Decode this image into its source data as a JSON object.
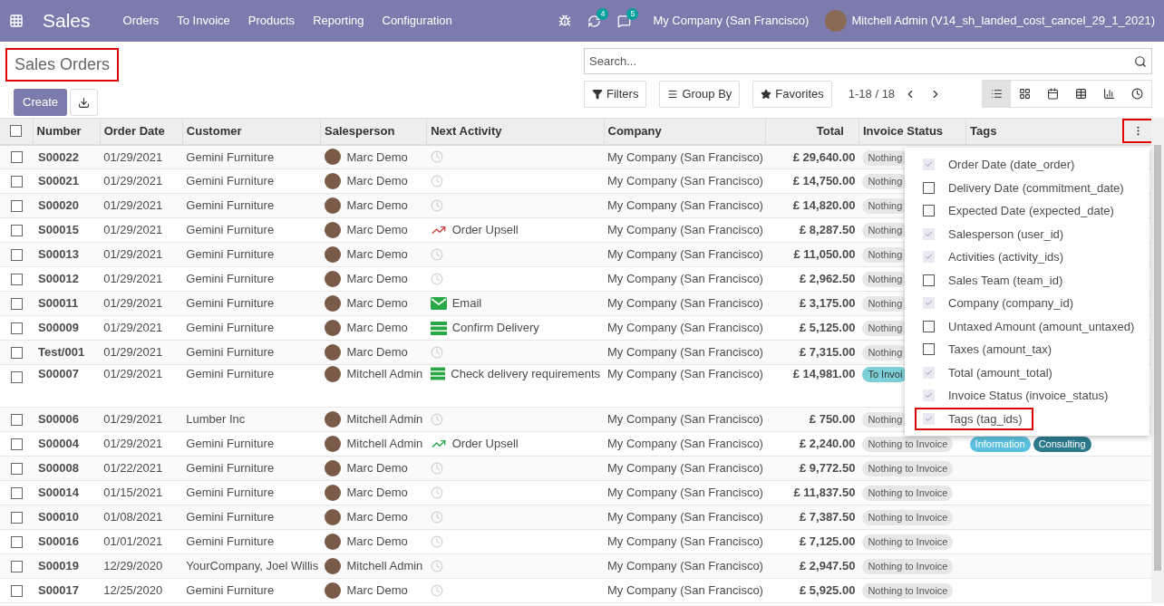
{
  "navbar": {
    "app": "Sales",
    "menu": [
      "Orders",
      "To Invoice",
      "Products",
      "Reporting",
      "Configuration"
    ],
    "activity_count": "4",
    "message_count": "5",
    "company": "My Company (San Francisco)",
    "user": "Mitchell Admin (V14_sh_landed_cost_cancel_29_1_2021)"
  },
  "title": {
    "text": "Sales Orders",
    "highlighted": true
  },
  "buttons": {
    "create": "Create"
  },
  "search": {
    "placeholder": "Search..."
  },
  "filters": [
    "Filters",
    "Group By",
    "Favorites"
  ],
  "pager": "1-18 / 18",
  "views": [
    {
      "kind": "list",
      "selected": true
    },
    {
      "kind": "kanban",
      "selected": false
    },
    {
      "kind": "calendar",
      "selected": false
    },
    {
      "kind": "pivot",
      "selected": false
    },
    {
      "kind": "graph",
      "selected": false
    },
    {
      "kind": "activity",
      "selected": false
    }
  ],
  "table": {
    "columns": [
      "Number",
      "Order Date",
      "Customer",
      "Salesperson",
      "Next Activity",
      "Company",
      "Total",
      "Invoice Status",
      "Tags"
    ],
    "menu_highlighted": true,
    "select_all_checked": false,
    "rows": [
      {
        "checked": false,
        "number": "S00022",
        "date": "01/29/2021",
        "customer": "Gemini Furniture",
        "salesperson": "Marc Demo",
        "activity": {
          "kind": "none"
        },
        "company": "My Company (San Francisco)",
        "total": "£ 29,640.00",
        "status": {
          "text": "Nothing",
          "kind": "nothing"
        },
        "tags": []
      },
      {
        "checked": false,
        "number": "S00021",
        "date": "01/29/2021",
        "customer": "Gemini Furniture",
        "salesperson": "Marc Demo",
        "activity": {
          "kind": "none"
        },
        "company": "My Company (San Francisco)",
        "total": "£ 14,750.00",
        "status": {
          "text": "Nothing",
          "kind": "nothing"
        },
        "tags": []
      },
      {
        "checked": false,
        "number": "S00020",
        "date": "01/29/2021",
        "customer": "Gemini Furniture",
        "salesperson": "Marc Demo",
        "activity": {
          "kind": "none"
        },
        "company": "My Company (San Francisco)",
        "total": "£ 14,820.00",
        "status": {
          "text": "Nothing",
          "kind": "nothing"
        },
        "tags": []
      },
      {
        "checked": false,
        "number": "S00015",
        "date": "01/29/2021",
        "customer": "Gemini Furniture",
        "salesperson": "Marc Demo",
        "activity": {
          "kind": "upsell",
          "label": "Order Upsell",
          "color": "#d23f3a"
        },
        "company": "My Company (San Francisco)",
        "total": "£ 8,287.50",
        "status": {
          "text": "Nothing",
          "kind": "nothing"
        },
        "tags": []
      },
      {
        "checked": false,
        "number": "S00013",
        "date": "01/29/2021",
        "customer": "Gemini Furniture",
        "salesperson": "Marc Demo",
        "activity": {
          "kind": "none"
        },
        "company": "My Company (San Francisco)",
        "total": "£ 11,050.00",
        "status": {
          "text": "Nothing",
          "kind": "nothing"
        },
        "tags": []
      },
      {
        "checked": false,
        "number": "S00012",
        "date": "01/29/2021",
        "customer": "Gemini Furniture",
        "salesperson": "Marc Demo",
        "activity": {
          "kind": "none"
        },
        "company": "My Company (San Francisco)",
        "total": "£ 2,962.50",
        "status": {
          "text": "Nothing",
          "kind": "nothing"
        },
        "tags": []
      },
      {
        "checked": false,
        "number": "S00011",
        "date": "01/29/2021",
        "customer": "Gemini Furniture",
        "salesperson": "Marc Demo",
        "activity": {
          "kind": "email",
          "label": "Email",
          "color": "#28a745"
        },
        "company": "My Company (San Francisco)",
        "total": "£ 3,175.00",
        "status": {
          "text": "Nothing",
          "kind": "nothing"
        },
        "tags": []
      },
      {
        "checked": false,
        "number": "S00009",
        "date": "01/29/2021",
        "customer": "Gemini Furniture",
        "salesperson": "Marc Demo",
        "activity": {
          "kind": "delivery",
          "label": "Confirm Delivery",
          "color": "#28a745"
        },
        "company": "My Company (San Francisco)",
        "total": "£ 5,125.00",
        "status": {
          "text": "Nothing",
          "kind": "nothing"
        },
        "tags": []
      },
      {
        "checked": false,
        "number": "Test/001",
        "date": "01/29/2021",
        "customer": "Gemini Furniture",
        "salesperson": "Marc Demo",
        "activity": {
          "kind": "none"
        },
        "company": "My Company (San Francisco)",
        "total": "£ 7,315.00",
        "status": {
          "text": "Nothing",
          "kind": "nothing"
        },
        "tags": []
      },
      {
        "checked": false,
        "number": "S00007",
        "date": "01/29/2021",
        "customer": "Gemini Furniture",
        "salesperson": "Mitchell Admin",
        "activity": {
          "kind": "delivery",
          "label": "Check delivery requirements",
          "color": "#28a745"
        },
        "company": "My Company (San Francisco)",
        "total": "£ 14,981.00",
        "status": {
          "text": "To Invoi",
          "kind": "to_invoice"
        },
        "tags": [],
        "wrapped": true
      },
      {
        "checked": false,
        "number": "S00006",
        "date": "01/29/2021",
        "customer": "Lumber Inc",
        "salesperson": "Mitchell Admin",
        "activity": {
          "kind": "none"
        },
        "company": "My Company (San Francisco)",
        "total": "£ 750.00",
        "status": {
          "text": "Nothing",
          "kind": "nothing"
        },
        "tags": []
      },
      {
        "checked": false,
        "number": "S00004",
        "date": "01/29/2021",
        "customer": "Gemini Furniture",
        "salesperson": "Mitchell Admin",
        "activity": {
          "kind": "upsell",
          "label": "Order Upsell",
          "color": "#28a745"
        },
        "company": "My Company (San Francisco)",
        "total": "£ 2,240.00",
        "status": {
          "text": "Nothing to Invoice",
          "kind": "nothing"
        },
        "tags": [
          {
            "label": "Information",
            "color": "#5bc0de"
          },
          {
            "label": "Consulting",
            "color": "#2c7a8c"
          }
        ]
      },
      {
        "checked": false,
        "number": "S00008",
        "date": "01/22/2021",
        "customer": "Gemini Furniture",
        "salesperson": "Marc Demo",
        "activity": {
          "kind": "none"
        },
        "company": "My Company (San Francisco)",
        "total": "£ 9,772.50",
        "status": {
          "text": "Nothing to Invoice",
          "kind": "nothing"
        },
        "tags": []
      },
      {
        "checked": false,
        "number": "S00014",
        "date": "01/15/2021",
        "customer": "Gemini Furniture",
        "salesperson": "Marc Demo",
        "activity": {
          "kind": "none"
        },
        "company": "My Company (San Francisco)",
        "total": "£ 11,837.50",
        "status": {
          "text": "Nothing to Invoice",
          "kind": "nothing"
        },
        "tags": []
      },
      {
        "checked": false,
        "number": "S00010",
        "date": "01/08/2021",
        "customer": "Gemini Furniture",
        "salesperson": "Marc Demo",
        "activity": {
          "kind": "none"
        },
        "company": "My Company (San Francisco)",
        "total": "£ 7,387.50",
        "status": {
          "text": "Nothing to Invoice",
          "kind": "nothing"
        },
        "tags": []
      },
      {
        "checked": false,
        "number": "S00016",
        "date": "01/01/2021",
        "customer": "Gemini Furniture",
        "salesperson": "Marc Demo",
        "activity": {
          "kind": "none"
        },
        "company": "My Company (San Francisco)",
        "total": "£ 7,125.00",
        "status": {
          "text": "Nothing to Invoice",
          "kind": "nothing"
        },
        "tags": []
      },
      {
        "checked": false,
        "number": "S00019",
        "date": "12/29/2020",
        "customer": "YourCompany, Joel Willis",
        "salesperson": "Mitchell Admin",
        "activity": {
          "kind": "none"
        },
        "company": "My Company (San Francisco)",
        "total": "£ 2,947.50",
        "status": {
          "text": "Nothing to Invoice",
          "kind": "nothing"
        },
        "tags": []
      },
      {
        "checked": false,
        "number": "S00017",
        "date": "12/25/2020",
        "customer": "Gemini Furniture",
        "salesperson": "Marc Demo",
        "activity": {
          "kind": "none"
        },
        "company": "My Company (San Francisco)",
        "total": "£ 5,925.00",
        "status": {
          "text": "Nothing to Invoice",
          "kind": "nothing"
        },
        "tags": []
      }
    ]
  },
  "column_menu": [
    {
      "label": "Order Date (date_order)",
      "checked": true,
      "highlighted": false
    },
    {
      "label": "Delivery Date (commitment_date)",
      "checked": false,
      "highlighted": false
    },
    {
      "label": "Expected Date (expected_date)",
      "checked": false,
      "highlighted": false
    },
    {
      "label": "Salesperson (user_id)",
      "checked": true,
      "highlighted": false
    },
    {
      "label": "Activities (activity_ids)",
      "checked": true,
      "highlighted": false
    },
    {
      "label": "Sales Team (team_id)",
      "checked": false,
      "highlighted": false
    },
    {
      "label": "Company (company_id)",
      "checked": true,
      "highlighted": false
    },
    {
      "label": "Untaxed Amount (amount_untaxed)",
      "checked": false,
      "highlighted": false
    },
    {
      "label": "Taxes (amount_tax)",
      "checked": false,
      "highlighted": false
    },
    {
      "label": "Total (amount_total)",
      "checked": true,
      "highlighted": false
    },
    {
      "label": "Invoice Status (invoice_status)",
      "checked": true,
      "highlighted": false
    },
    {
      "label": "Tags (tag_ids)",
      "checked": true,
      "highlighted": true
    }
  ]
}
